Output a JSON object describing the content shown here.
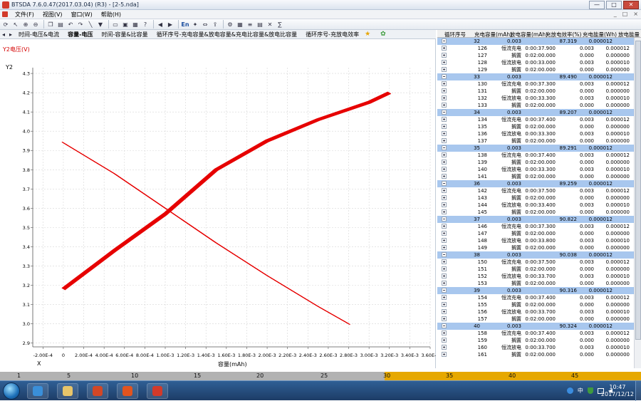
{
  "app": {
    "title": "BTSDA 7.6.0.47(2017.03.04) (R3) - [2-5.nda]"
  },
  "menu": [
    "文件(F)",
    "视图(V)",
    "窗口(W)",
    "帮助(H)"
  ],
  "mdi_buttons": [
    "_",
    "□",
    "×"
  ],
  "window_buttons": [
    "—",
    "□",
    "✕"
  ],
  "toolbar_icons": [
    "refresh-icon",
    "cursor-icon",
    "zoom-in-icon",
    "zoom-out-icon",
    "copy-icon",
    "paste-icon",
    "undo-icon",
    "redo-icon",
    "line-icon",
    "filter-icon",
    "open-icon",
    "save-icon",
    "print-icon",
    "help-icon",
    "back-icon",
    "forward-icon",
    "language-icon",
    "pin-icon",
    "fit-icon",
    "export-icon",
    "settings-icon",
    "grid-icon",
    "list-icon",
    "table-icon",
    "excel-icon",
    "formula-icon"
  ],
  "toolbar_text": {
    "lang": "En"
  },
  "tabs": [
    "时间-电压&电流",
    "容量-电压",
    "时间-容量&比容量",
    "循环序号-充电容量&放电容量&充电比容量&放电比容量",
    "循环序号-充放电效率"
  ],
  "chart": {
    "series_title": "Y2电压(V)",
    "y_axis_name": "Y2",
    "x_axis_name": "X",
    "x_axis_label": "容量(mAh)",
    "y_ticks": [
      "2.9",
      "3.0",
      "3.1",
      "3.2",
      "3.3",
      "3.4",
      "3.5",
      "3.6",
      "3.7",
      "3.8",
      "3.9",
      "4.0",
      "4.1",
      "4.2",
      "4.3"
    ],
    "x_ticks": [
      "-2.00E-4",
      "0",
      "2.00E-4",
      "4.00E-4",
      "6.00E-4",
      "8.00E-4",
      "1.00E-3",
      "1.20E-3",
      "1.40E-3",
      "1.60E-3",
      "1.80E-3",
      "2.00E-3",
      "2.20E-3",
      "2.40E-3",
      "2.60E-3",
      "2.80E-3",
      "3.00E-3",
      "3.20E-3",
      "3.40E-3",
      "3.60E-3"
    ]
  },
  "chart_data": {
    "type": "line",
    "xlabel": "容量(mAh)",
    "ylabel": "Y2电压(V)",
    "xlim": [
      -0.0003,
      0.0036
    ],
    "ylim": [
      2.88,
      4.33
    ],
    "grid": true,
    "series": [
      {
        "name": "",
        "x": [
          0,
          0.0005,
          0.001,
          0.0015,
          0.002,
          0.0025,
          0.003,
          0.0032
        ],
        "y": [
          3.18,
          3.38,
          3.57,
          3.8,
          3.95,
          4.06,
          4.15,
          4.2
        ]
      },
      {
        "name": "",
        "x": [
          0,
          0.0005,
          0.001,
          0.0015,
          0.002,
          0.0025,
          0.0028
        ],
        "y": [
          3.94,
          3.78,
          3.6,
          3.42,
          3.25,
          3.09,
          3.0
        ]
      }
    ]
  },
  "table": {
    "headers": [
      "循环序号",
      "充电容量(mAh)",
      "放电容量(mAh)",
      "充放电效率(%)",
      "充电能量(Wh)",
      "放电能量"
    ],
    "cycles": [
      {
        "cycle": "32",
        "col2": "0.003",
        "eff": "87.319",
        "energy": "0.000012",
        "steps": [
          [
            "126",
            "恒流充电",
            "0:00:37.900",
            "0.003",
            "0.000012"
          ],
          [
            "127",
            "搁置",
            "0:02:00.000",
            "0.000",
            "0.000000"
          ],
          [
            "128",
            "恒流放电",
            "0:00:33.000",
            "0.003",
            "0.000010"
          ],
          [
            "129",
            "搁置",
            "0:02:00.000",
            "0.000",
            "0.000000"
          ]
        ]
      },
      {
        "cycle": "33",
        "col2": "0.003",
        "eff": "89.490",
        "energy": "0.000012",
        "steps": [
          [
            "130",
            "恒流充电",
            "0:00:37.300",
            "0.003",
            "0.000012"
          ],
          [
            "131",
            "搁置",
            "0:02:00.000",
            "0.000",
            "0.000000"
          ],
          [
            "132",
            "恒流放电",
            "0:00:33.300",
            "0.003",
            "0.000010"
          ],
          [
            "133",
            "搁置",
            "0:02:00.000",
            "0.000",
            "0.000000"
          ]
        ]
      },
      {
        "cycle": "34",
        "col2": "0.003",
        "eff": "89.207",
        "energy": "0.000012",
        "steps": [
          [
            "134",
            "恒流充电",
            "0:00:37.400",
            "0.003",
            "0.000012"
          ],
          [
            "135",
            "搁置",
            "0:02:00.000",
            "0.000",
            "0.000000"
          ],
          [
            "136",
            "恒流放电",
            "0:00:33.300",
            "0.003",
            "0.000010"
          ],
          [
            "137",
            "搁置",
            "0:02:00.000",
            "0.000",
            "0.000000"
          ]
        ]
      },
      {
        "cycle": "35",
        "col2": "0.003",
        "eff": "89.291",
        "energy": "0.000012",
        "steps": [
          [
            "138",
            "恒流充电",
            "0:00:37.400",
            "0.003",
            "0.000012"
          ],
          [
            "139",
            "搁置",
            "0:02:00.000",
            "0.000",
            "0.000000"
          ],
          [
            "140",
            "恒流放电",
            "0:00:33.300",
            "0.003",
            "0.000010"
          ],
          [
            "141",
            "搁置",
            "0:02:00.000",
            "0.000",
            "0.000000"
          ]
        ]
      },
      {
        "cycle": "36",
        "col2": "0.003",
        "eff": "89.259",
        "energy": "0.000012",
        "steps": [
          [
            "142",
            "恒流充电",
            "0:00:37.500",
            "0.003",
            "0.000012"
          ],
          [
            "143",
            "搁置",
            "0:02:00.000",
            "0.000",
            "0.000000"
          ],
          [
            "144",
            "恒流放电",
            "0:00:33.400",
            "0.003",
            "0.000010"
          ],
          [
            "145",
            "搁置",
            "0:02:00.000",
            "0.000",
            "0.000000"
          ]
        ]
      },
      {
        "cycle": "37",
        "col2": "0.003",
        "eff": "90.822",
        "energy": "0.000012",
        "steps": [
          [
            "146",
            "恒流充电",
            "0:00:37.300",
            "0.003",
            "0.000012"
          ],
          [
            "147",
            "搁置",
            "0:02:00.000",
            "0.000",
            "0.000000"
          ],
          [
            "148",
            "恒流放电",
            "0:00:33.800",
            "0.003",
            "0.000010"
          ],
          [
            "149",
            "搁置",
            "0:02:00.000",
            "0.000",
            "0.000000"
          ]
        ]
      },
      {
        "cycle": "38",
        "col2": "0.003",
        "eff": "90.038",
        "energy": "0.000012",
        "steps": [
          [
            "150",
            "恒流充电",
            "0:00:37.500",
            "0.003",
            "0.000012"
          ],
          [
            "151",
            "搁置",
            "0:02:00.000",
            "0.000",
            "0.000000"
          ],
          [
            "152",
            "恒流放电",
            "0:00:33.700",
            "0.003",
            "0.000010"
          ],
          [
            "153",
            "搁置",
            "0:02:00.000",
            "0.000",
            "0.000000"
          ]
        ]
      },
      {
        "cycle": "39",
        "col2": "0.003",
        "eff": "90.316",
        "energy": "0.000012",
        "steps": [
          [
            "154",
            "恒流充电",
            "0:00:37.400",
            "0.003",
            "0.000012"
          ],
          [
            "155",
            "搁置",
            "0:02:00.000",
            "0.000",
            "0.000000"
          ],
          [
            "156",
            "恒流放电",
            "0:00:33.700",
            "0.003",
            "0.000010"
          ],
          [
            "157",
            "搁置",
            "0:02:00.000",
            "0.000",
            "0.000000"
          ]
        ]
      },
      {
        "cycle": "40",
        "col2": "0.003",
        "eff": "90.324",
        "energy": "0.000012",
        "steps": [
          [
            "158",
            "恒流充电",
            "0:00:37.400",
            "0.003",
            "0.000012"
          ],
          [
            "159",
            "搁置",
            "0:02:00.000",
            "0.000",
            "0.000000"
          ],
          [
            "160",
            "恒流放电",
            "0:00:33.700",
            "0.003",
            "0.000010"
          ],
          [
            "161",
            "搁置",
            "0:02:00.000",
            "0.000",
            "0.000000"
          ]
        ]
      }
    ]
  },
  "bottom_scale": {
    "ticks": [
      "1",
      "5",
      "10",
      "15",
      "20",
      "25",
      "30",
      "35",
      "40",
      "45"
    ],
    "progress": 0.6
  },
  "taskbar": {
    "apps": [
      "sogou-browser-icon",
      "file-explorer-icon",
      "powerpoint-icon",
      "pdf-icon",
      "btsda-icon"
    ],
    "tray_lang": "中",
    "time": "10:47",
    "date": "2017/12/12"
  }
}
